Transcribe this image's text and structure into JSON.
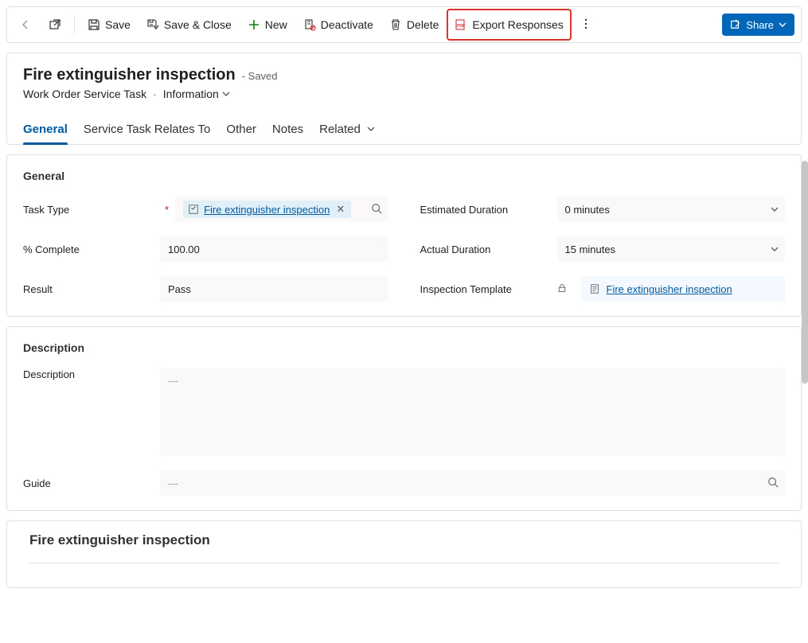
{
  "commands": {
    "save": "Save",
    "save_close": "Save & Close",
    "new": "New",
    "deactivate": "Deactivate",
    "delete": "Delete",
    "export_responses": "Export Responses",
    "share": "Share"
  },
  "header": {
    "title": "Fire extinguisher inspection",
    "saved": "- Saved",
    "entity": "Work Order Service Task",
    "form": "Information"
  },
  "tabs": {
    "general": "General",
    "relates": "Service Task Relates To",
    "other": "Other",
    "notes": "Notes",
    "related": "Related"
  },
  "section_general": {
    "title": "General",
    "task_type_label": "Task Type",
    "task_type_value": "Fire extinguisher inspection",
    "percent_label": "% Complete",
    "percent_value": "100.00",
    "result_label": "Result",
    "result_value": "Pass",
    "est_label": "Estimated Duration",
    "est_value": "0 minutes",
    "act_label": "Actual Duration",
    "act_value": "15 minutes",
    "template_label": "Inspection Template",
    "template_value": "Fire extinguisher inspection"
  },
  "section_desc": {
    "title": "Description",
    "desc_label": "Description",
    "desc_value": "---",
    "guide_label": "Guide",
    "guide_value": "---"
  },
  "section_bottom": {
    "title": "Fire extinguisher inspection"
  }
}
